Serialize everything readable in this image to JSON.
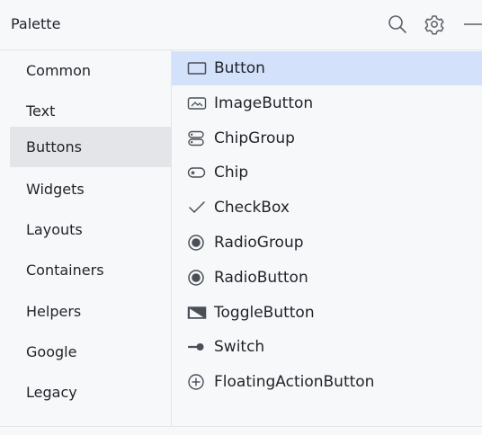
{
  "header": {
    "title": "Palette",
    "icons": [
      "search-icon",
      "gear-icon",
      "minimize-icon"
    ]
  },
  "sidebar": {
    "selected": "Buttons",
    "items": [
      {
        "label": "Common"
      },
      {
        "label": "Text"
      },
      {
        "label": "Buttons"
      },
      {
        "label": "Widgets"
      },
      {
        "label": "Layouts"
      },
      {
        "label": "Containers"
      },
      {
        "label": "Helpers"
      },
      {
        "label": "Google"
      },
      {
        "label": "Legacy"
      }
    ]
  },
  "main": {
    "selected": "Button",
    "items": [
      {
        "label": "Button",
        "icon": "button-icon"
      },
      {
        "label": "ImageButton",
        "icon": "image-button-icon"
      },
      {
        "label": "ChipGroup",
        "icon": "chip-group-icon"
      },
      {
        "label": "Chip",
        "icon": "chip-icon"
      },
      {
        "label": "CheckBox",
        "icon": "checkmark-icon"
      },
      {
        "label": "RadioGroup",
        "icon": "radio-group-icon"
      },
      {
        "label": "RadioButton",
        "icon": "radio-button-icon"
      },
      {
        "label": "ToggleButton",
        "icon": "toggle-button-icon"
      },
      {
        "label": "Switch",
        "icon": "switch-icon"
      },
      {
        "label": "FloatingActionButton",
        "icon": "fab-plus-icon"
      }
    ]
  },
  "colors": {
    "background": "#f7f8fa",
    "sidebar_selected": "#e3e5e9",
    "item_selected": "#d3e1fb",
    "icon": "#4a4f57",
    "text": "#1f2329"
  }
}
